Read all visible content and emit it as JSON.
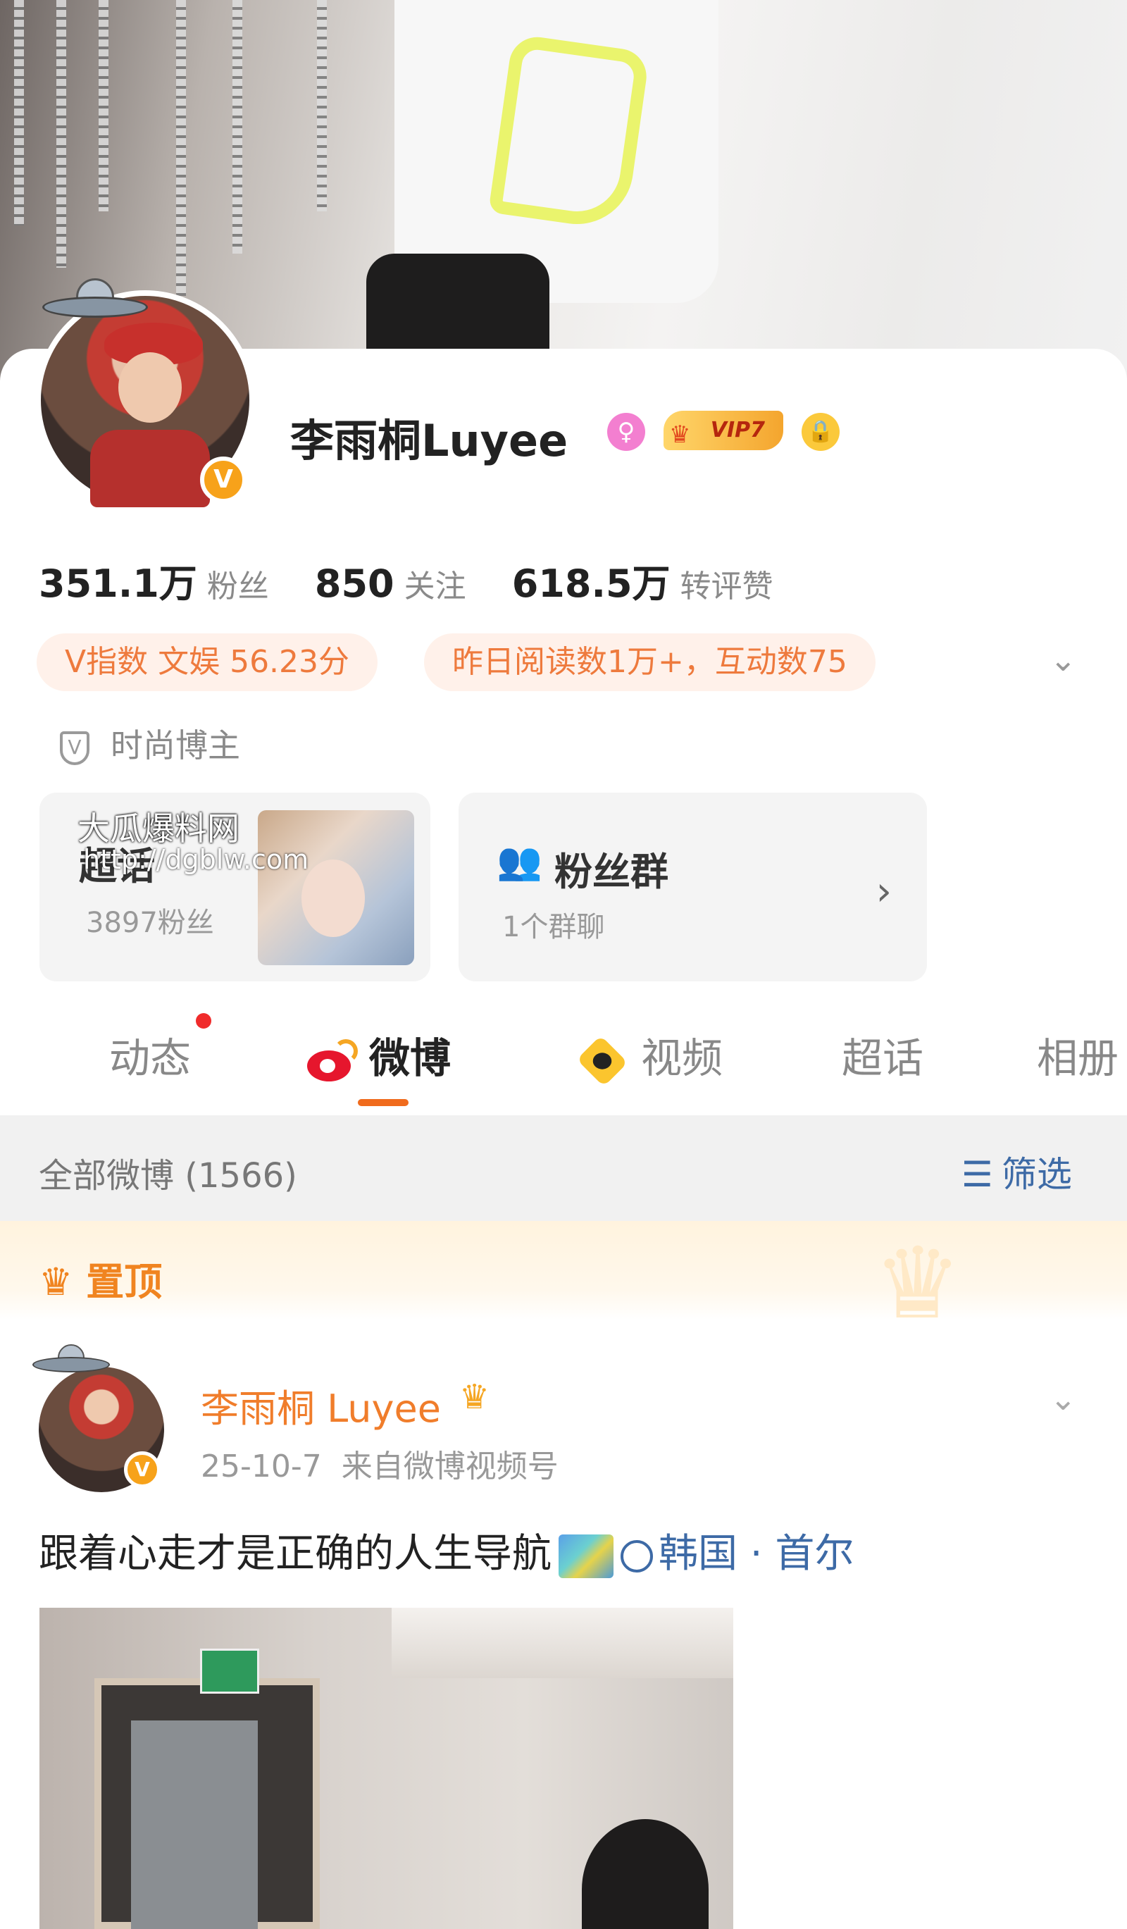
{
  "profile": {
    "name": "李雨桐Luyee",
    "gender_icon": "female-icon",
    "vip_label": "VIP7",
    "verified_badge": "V",
    "stats": [
      {
        "value": "351.1万",
        "label": "粉丝"
      },
      {
        "value": "850",
        "label": "关注"
      },
      {
        "value": "618.5万",
        "label": "转评赞"
      }
    ],
    "pills": [
      "V指数 文娱 56.23分",
      "昨日阅读数1万+，互动数75"
    ],
    "tag": "时尚博主"
  },
  "cards": {
    "supertopic": {
      "title": "超话",
      "sub": "3897粉丝"
    },
    "fangroup": {
      "title": "粉丝群",
      "sub": "1个群聊"
    }
  },
  "watermark": {
    "line1": "大瓜爆料网",
    "line2": "http://dgblw.com"
  },
  "tabs": [
    "动态",
    "微博",
    "视频",
    "超话",
    "相册"
  ],
  "active_tab": "微博",
  "filterbar": {
    "count_label": "全部微博 (1566)",
    "filter_label": "筛选"
  },
  "pinned_label": "置顶",
  "post": {
    "author": "李雨桐 Luyee",
    "date": "25-10-7",
    "source": "来自微博视频号",
    "text": "跟着心走才是正确的人生导航",
    "location": "韩国 · 首尔"
  },
  "colors": {
    "accent_orange": "#f06b1d",
    "link_blue": "#3d6aa6",
    "pill_text": "#ee7a3d",
    "pill_bg": "#fff1ea"
  }
}
